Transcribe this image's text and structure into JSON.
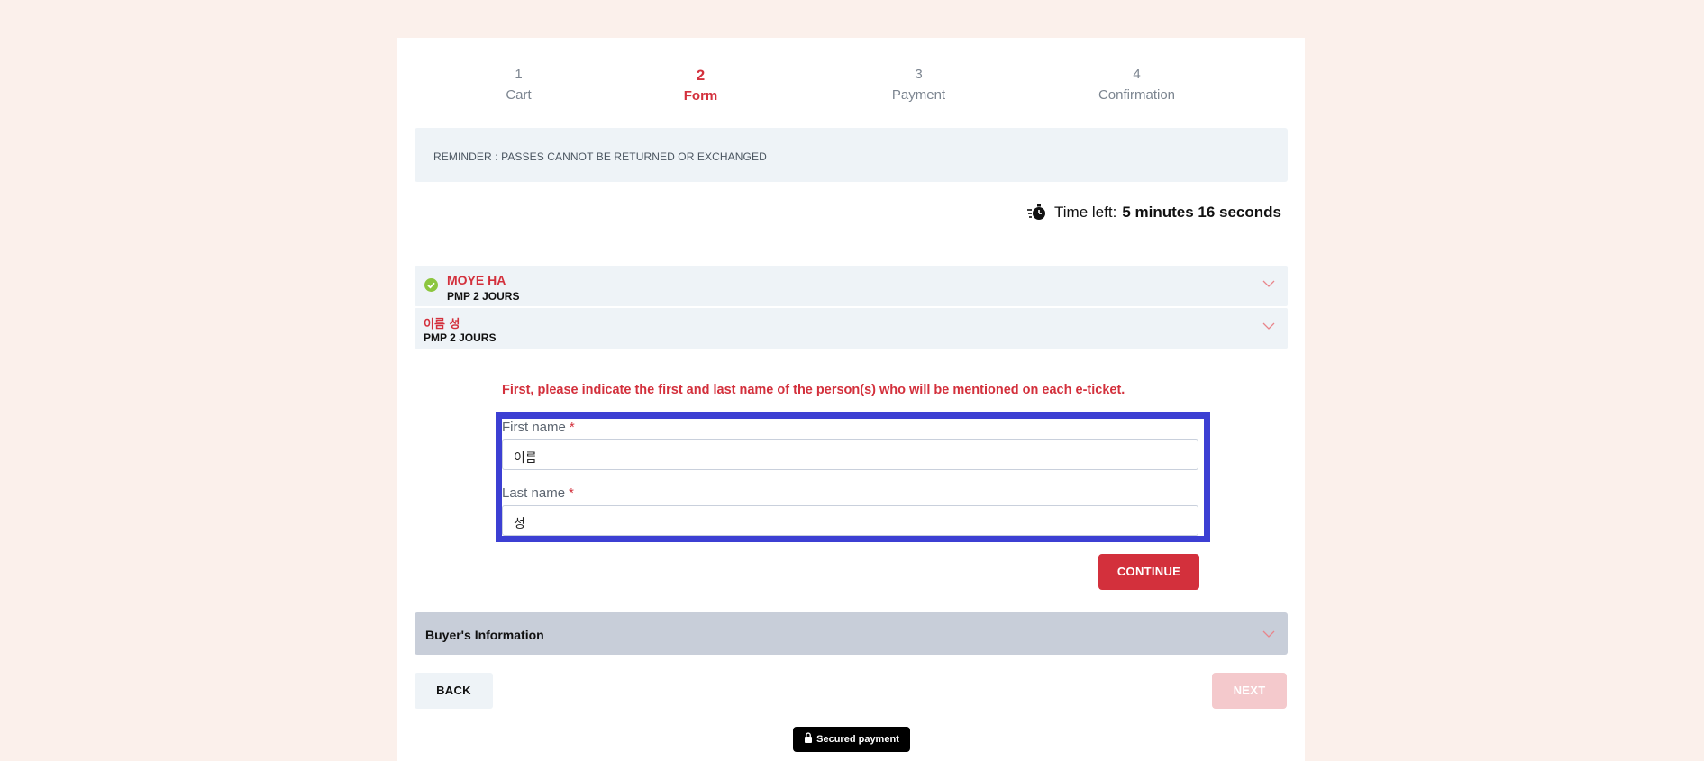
{
  "stepper": {
    "steps": [
      {
        "num": "1",
        "label": "Cart"
      },
      {
        "num": "2",
        "label": "Form"
      },
      {
        "num": "3",
        "label": "Payment"
      },
      {
        "num": "4",
        "label": "Confirmation"
      }
    ],
    "active_index": 1
  },
  "reminder": {
    "text": "REMINDER : PASSES CANNOT BE RETURNED OR EXCHANGED"
  },
  "timer": {
    "label": "Time left:",
    "value": "5 minutes 16 seconds",
    "icon": "stopwatch-icon"
  },
  "participants": [
    {
      "name": "MOYE HA",
      "pass": "PMP 2 JOURS",
      "completed": true
    },
    {
      "name": "이름 성",
      "pass": "PMP 2 JOURS",
      "completed": false
    }
  ],
  "form": {
    "instruction": "First, please indicate the first and last name of the person(s) who will be mentioned on each e-ticket.",
    "first_name_label": "First name",
    "first_name_value": "이름",
    "last_name_label": "Last name",
    "last_name_value": "성",
    "required_mark": "*",
    "continue_label": "CONTINUE"
  },
  "buyer": {
    "label": "Buyer's Information"
  },
  "nav": {
    "back_label": "BACK",
    "next_label": "NEXT"
  },
  "secured": {
    "label": "Secured payment"
  },
  "colors": {
    "accent": "#d3303c",
    "background": "#fbf0eb",
    "highlight": "#3c3fd3",
    "check": "#8cc63f"
  }
}
